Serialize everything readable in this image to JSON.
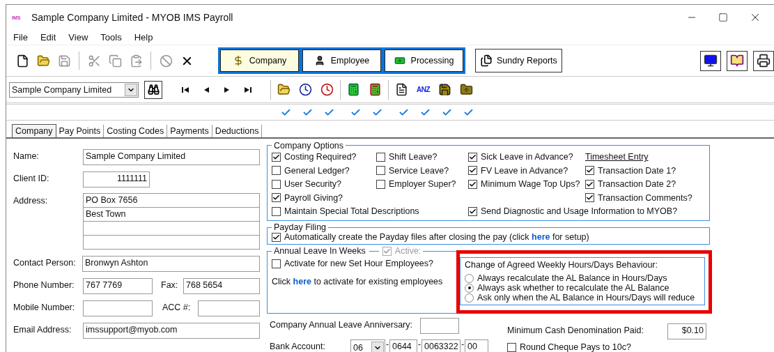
{
  "window": {
    "app_icon": "IMS",
    "title": "Sample Company Limited - MYOB IMS Payroll"
  },
  "menu": [
    "File",
    "Edit",
    "View",
    "Tools",
    "Help"
  ],
  "toolbar": [
    {
      "kind": "new",
      "disabled": false
    },
    {
      "kind": "open",
      "disabled": false
    },
    {
      "kind": "save",
      "disabled": true
    },
    {
      "kind": "separator"
    },
    {
      "kind": "cut",
      "disabled": true
    },
    {
      "kind": "copy",
      "disabled": true
    },
    {
      "kind": "paste",
      "disabled": true
    },
    {
      "kind": "separator"
    },
    {
      "kind": "cancel",
      "disabled": true
    },
    {
      "kind": "delete",
      "disabled": false
    }
  ],
  "modules": [
    {
      "kind": "company",
      "label": "Company",
      "selected": true
    },
    {
      "kind": "employee",
      "label": "Employee",
      "selected": false
    },
    {
      "kind": "processing",
      "label": "Processing",
      "selected": false
    }
  ],
  "reports_button": "Sundry Reports",
  "right_tools": [
    {
      "kind": "monitor"
    },
    {
      "kind": "book"
    },
    {
      "kind": "printer"
    }
  ],
  "company_select": "Sample Company Limited",
  "nav": [
    {
      "kind": "first"
    },
    {
      "kind": "prev"
    },
    {
      "kind": "next"
    },
    {
      "kind": "last"
    }
  ],
  "quick_tools": [
    {
      "kind": "open",
      "checked": true
    },
    {
      "kind": "clock",
      "checked": true
    },
    {
      "kind": "clock-alert",
      "checked": true
    },
    {
      "kind": "separator"
    },
    {
      "kind": "calculator",
      "checked": true
    },
    {
      "kind": "calculator-alert",
      "checked": true
    },
    {
      "kind": "separator"
    },
    {
      "kind": "document",
      "checked": true
    },
    {
      "kind": "bank",
      "label": "ANZ",
      "checked": true
    },
    {
      "kind": "save",
      "checked": true
    },
    {
      "kind": "folder-up",
      "checked": true
    }
  ],
  "tabs": [
    {
      "label": "Company",
      "selected": true
    },
    {
      "label": "Pay Points",
      "selected": false
    },
    {
      "label": "Costing Codes",
      "selected": false
    },
    {
      "label": "Payments",
      "selected": false
    },
    {
      "label": "Deductions",
      "selected": false
    }
  ],
  "details": {
    "name": {
      "label": "Name:",
      "value": "Sample Company Limited"
    },
    "client_id": {
      "label": "Client ID:",
      "value": "1111111"
    },
    "address": {
      "label": "Address:",
      "lines": [
        "PO Box 7656",
        "Best Town"
      ]
    },
    "contact": {
      "label": "Contact Person:",
      "value": "Bronwyn Ashton"
    },
    "phone": {
      "label": "Phone Number:",
      "value": "767 7769"
    },
    "fax": {
      "label": "Fax:",
      "value": "768 5654"
    },
    "mobile": {
      "label": "Mobile Number:"
    },
    "acc": {
      "label": "ACC #:"
    },
    "email": {
      "label": "Email Address:",
      "value": "imssupport@myob.com"
    }
  },
  "company_options": {
    "title": "Company Options",
    "rows": [
      [
        {
          "label": "Costing Required?",
          "checked": true
        },
        {
          "label": "Shift Leave?",
          "checked": false
        },
        {
          "label": "Sick Leave in Advance?",
          "checked": true
        }
      ],
      [
        {
          "label": "General Ledger?",
          "checked": false
        },
        {
          "label": "Service Leave?",
          "checked": false
        },
        {
          "label": "FV Leave in Advance?",
          "checked": true
        }
      ],
      [
        {
          "label": "User Security?",
          "checked": false
        },
        {
          "label": "Employer Super?",
          "checked": false
        },
        {
          "label": "Minimum Wage Top Ups?",
          "checked": true
        }
      ],
      [
        {
          "label": "Payroll Giving?",
          "checked": true
        }
      ],
      [
        {
          "label": "Maintain Special Total Descriptions",
          "checked": false
        },
        null,
        {
          "label": "Send Diagnostic and Usage Information to MYOB?",
          "checked": true
        }
      ]
    ],
    "timesheet": {
      "title": "Timesheet Entry",
      "options": [
        {
          "label": "Transaction Date 1?",
          "checked": true
        },
        {
          "label": "Transaction Date 2?",
          "checked": true
        },
        {
          "label": "Transaction Comments?",
          "checked": true
        }
      ]
    }
  },
  "payday_filing": {
    "title": "Payday Filing",
    "checked": true,
    "text": "Automatically create the Payday files after closing the pay (click",
    "link": "here",
    "text_after": "for setup)"
  },
  "annual_leave": {
    "title": "Annual Leave In Weeks",
    "active": {
      "label": "Active:",
      "checked": true,
      "disabled": true
    },
    "new_employees": {
      "label": "Activate for new Set Hour Employees?",
      "checked": false
    },
    "existing": {
      "text": "Click",
      "link": "here",
      "text_after": "to activate for existing employees"
    },
    "behaviour": {
      "title": "Change of Agreed Weekly Hours/Days Behaviour:",
      "highlighted": true,
      "options": [
        {
          "label": "Always recalculate the AL Balance in Hours/Days",
          "selected": false
        },
        {
          "label": "Always ask whether to recalculate the AL Balance",
          "selected": true
        },
        {
          "label": "Ask only when the AL Balance in Hours/Days will reduce",
          "selected": false
        }
      ]
    }
  },
  "anniversary": {
    "label": "Company Annual Leave Anniversary:"
  },
  "bank_account": {
    "label": "Bank Account:",
    "bank": "06",
    "separator": "-",
    "branch": "0644",
    "account": "0063322",
    "suffix": "00"
  },
  "min_cash": {
    "label": "Minimum Cash Denomination Paid:",
    "value": "$0.10"
  },
  "round_cheque": {
    "label": "Round Cheque Pays to 10c?",
    "checked": false
  }
}
